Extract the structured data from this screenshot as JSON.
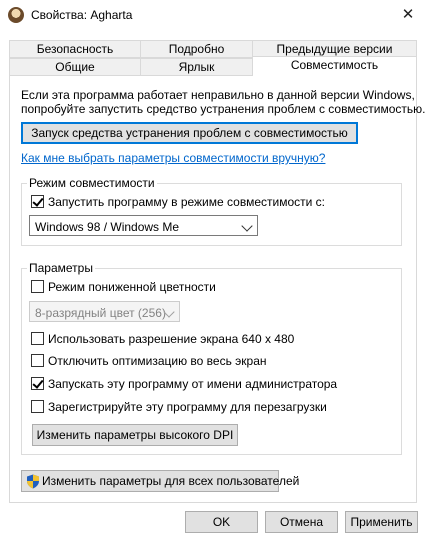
{
  "window": {
    "title": "Свойства: Agharta",
    "close_glyph": "✕"
  },
  "tabs": {
    "row1": [
      "Безопасность",
      "Подробно",
      "Предыдущие версии"
    ],
    "row2": [
      "Общие",
      "Ярлык",
      "Совместимость"
    ],
    "active": "Совместимость"
  },
  "intro": {
    "line1": "Если эта программа работает неправильно в данной версии Windows,",
    "line2": "попробуйте запустить средство устранения проблем с совместимостью."
  },
  "troubleshoot_button": "Запуск средства устранения проблем с совместимостью",
  "help_link": "Как мне выбрать параметры совместимости вручную?",
  "compat_mode": {
    "legend": "Режим совместимости",
    "checkbox_label": "Запустить программу в режиме совместимости с:",
    "checked": true,
    "selected_os": "Windows 98 / Windows Me"
  },
  "settings": {
    "legend": "Параметры",
    "reduced_color": {
      "label": "Режим пониженной цветности",
      "checked": false
    },
    "color_select": "8-разрядный цвет (256)",
    "res640": {
      "label": "Использовать разрешение экрана 640 x 480",
      "checked": false
    },
    "disable_fullscreen": {
      "label": "Отключить оптимизацию во весь экран",
      "checked": false
    },
    "run_admin": {
      "label": "Запускать эту программу от имени администратора",
      "checked": true
    },
    "register_restart": {
      "label": "Зарегистрируйте эту программу для перезагрузки",
      "checked": false
    },
    "dpi_button": "Изменить параметры высокого DPI"
  },
  "all_users_button": "Изменить параметры для всех пользователей",
  "footer": {
    "ok": "OK",
    "cancel": "Отмена",
    "apply": "Применить"
  },
  "colors": {
    "link": "#0066cc",
    "focus_border": "#0078d7",
    "button_bg": "#e1e1e1"
  }
}
